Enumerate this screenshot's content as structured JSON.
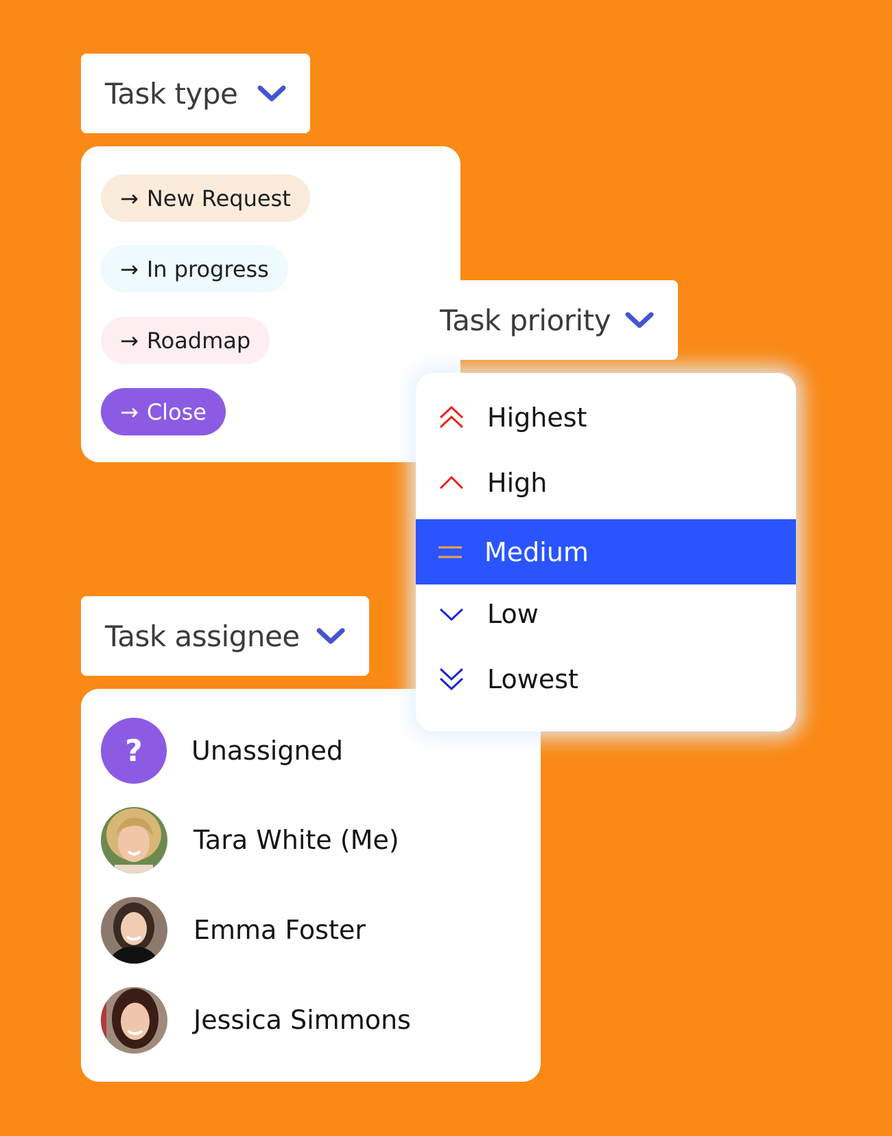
{
  "task_type": {
    "label": "Task type",
    "options": [
      {
        "label": "New Request",
        "bg": "#FAEBDB",
        "fg": "#1f1f1f"
      },
      {
        "label": "In progress",
        "bg": "#EEFAFE",
        "fg": "#1f1f1f"
      },
      {
        "label": "Roadmap",
        "bg": "#FDEEF2",
        "fg": "#1f1f1f"
      },
      {
        "label": "Close",
        "bg": "#8C5BE4",
        "fg": "#ffffff"
      }
    ]
  },
  "task_priority": {
    "label": "Task priority",
    "selected": "Medium",
    "options": [
      {
        "label": "Highest",
        "icon": "double-chevron-up-icon",
        "color": "#E8231F"
      },
      {
        "label": "High",
        "icon": "chevron-up-icon",
        "color": "#E8231F"
      },
      {
        "label": "Medium",
        "icon": "equals-icon",
        "color": "#F0A34A"
      },
      {
        "label": "Low",
        "icon": "chevron-down-icon",
        "color": "#1A24D6"
      },
      {
        "label": "Lowest",
        "icon": "double-chevron-down-icon",
        "color": "#1A24D6"
      }
    ]
  },
  "task_assignee": {
    "label": "Task assignee",
    "options": [
      {
        "label": "Unassigned",
        "avatar": "question-icon",
        "avatar_glyph": "?"
      },
      {
        "label": "Tara White (Me)",
        "avatar": "avatar-photo"
      },
      {
        "label": "Emma Foster",
        "avatar": "avatar-photo"
      },
      {
        "label": "Jessica Simmons",
        "avatar": "avatar-photo"
      }
    ]
  },
  "colors": {
    "background": "#FA8916",
    "accent_chevron": "#4455CF",
    "selected_row": "#2A55FE"
  }
}
